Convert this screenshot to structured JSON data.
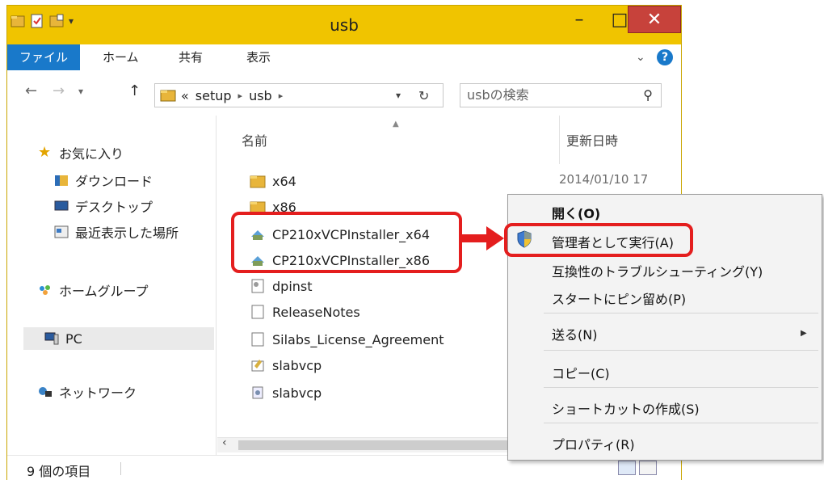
{
  "window": {
    "title": "usb",
    "controls": {
      "minimize": "–",
      "maximize": "□",
      "close": "✕"
    }
  },
  "ribbon": {
    "tabs": [
      "ファイル",
      "ホーム",
      "共有",
      "表示"
    ],
    "help": "?"
  },
  "nav": {
    "back": "←",
    "forward": "→",
    "recent": "▾",
    "up": "↑",
    "address": {
      "overflow": "«",
      "segments": [
        "setup",
        "usb"
      ],
      "sep": "▸"
    },
    "dropdown": "▾",
    "refresh": "↻",
    "search_placeholder": "usbの検索",
    "search_icon": "⚲"
  },
  "sidebar": {
    "favorites": "お気に入り",
    "favorites_items": [
      "ダウンロード",
      "デスクトップ",
      "最近表示した場所"
    ],
    "homegroup": "ホームグループ",
    "pc": "PC",
    "network": "ネットワーク"
  },
  "files": {
    "col_name": "名前",
    "col_date": "更新日時",
    "rows": [
      {
        "name": "x64",
        "icon": "folder-icon",
        "date": "2014/01/10 17"
      },
      {
        "name": "x86",
        "icon": "folder-icon",
        "date": ""
      },
      {
        "name": "CP210xVCPInstaller_x64",
        "icon": "installer-icon",
        "date": ""
      },
      {
        "name": "CP210xVCPInstaller_x86",
        "icon": "installer-icon",
        "date": ""
      },
      {
        "name": "dpinst",
        "icon": "config-file-icon",
        "date": ""
      },
      {
        "name": "ReleaseNotes",
        "icon": "text-file-icon",
        "date": ""
      },
      {
        "name": "Silabs_License_Agreement",
        "icon": "text-file-icon",
        "date": ""
      },
      {
        "name": "slabvcp",
        "icon": "catalog-file-icon",
        "date": ""
      },
      {
        "name": "slabvcp",
        "icon": "setup-info-icon",
        "date": ""
      }
    ]
  },
  "status": {
    "item_count": "9 個の項目"
  },
  "context_menu": {
    "items": [
      {
        "label": "開く(O)",
        "bold": true
      },
      {
        "label": "管理者として実行(A)",
        "icon": "uac-shield-icon"
      },
      {
        "label": "互換性のトラブルシューティング(Y)"
      },
      {
        "label": "スタートにピン留め(P)"
      },
      {
        "label": "送る(N)",
        "submenu": true
      },
      {
        "label": "コピー(C)"
      },
      {
        "label": "ショートカットの作成(S)"
      },
      {
        "label": "プロパティ(R)"
      }
    ]
  },
  "colors": {
    "accent": "#1979ca",
    "highlight_annotation": "#e41e1e",
    "window_frame": "#f0c400",
    "close_button": "#c7423b"
  }
}
